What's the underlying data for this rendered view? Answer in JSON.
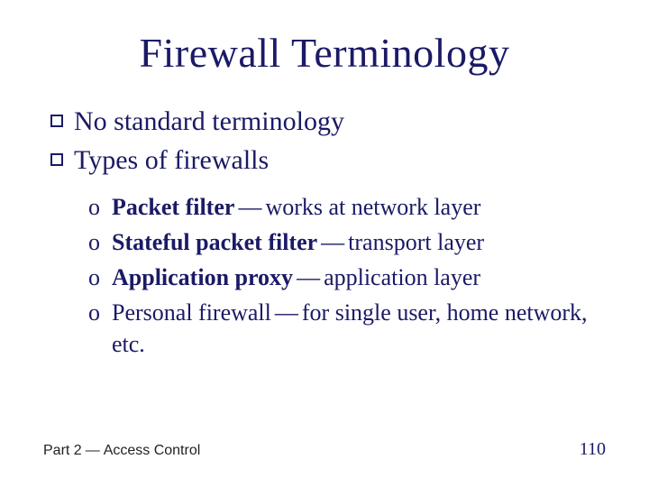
{
  "title": "Firewall Terminology",
  "bullets": [
    {
      "text": "No standard terminology"
    },
    {
      "text": "Types of firewalls"
    }
  ],
  "subitems": [
    {
      "bold": "Packet filter",
      "rest": "works at network layer"
    },
    {
      "bold": "Stateful packet filter",
      "rest": "transport layer"
    },
    {
      "bold": "Application proxy",
      "rest": "application layer"
    },
    {
      "bold": "",
      "plain": "Personal firewall",
      "rest": "for single user, home network, etc."
    }
  ],
  "footer": {
    "part": "Part 2",
    "section": "Access Control",
    "page": "110"
  },
  "markers": {
    "o": "o",
    "dash": "—"
  }
}
